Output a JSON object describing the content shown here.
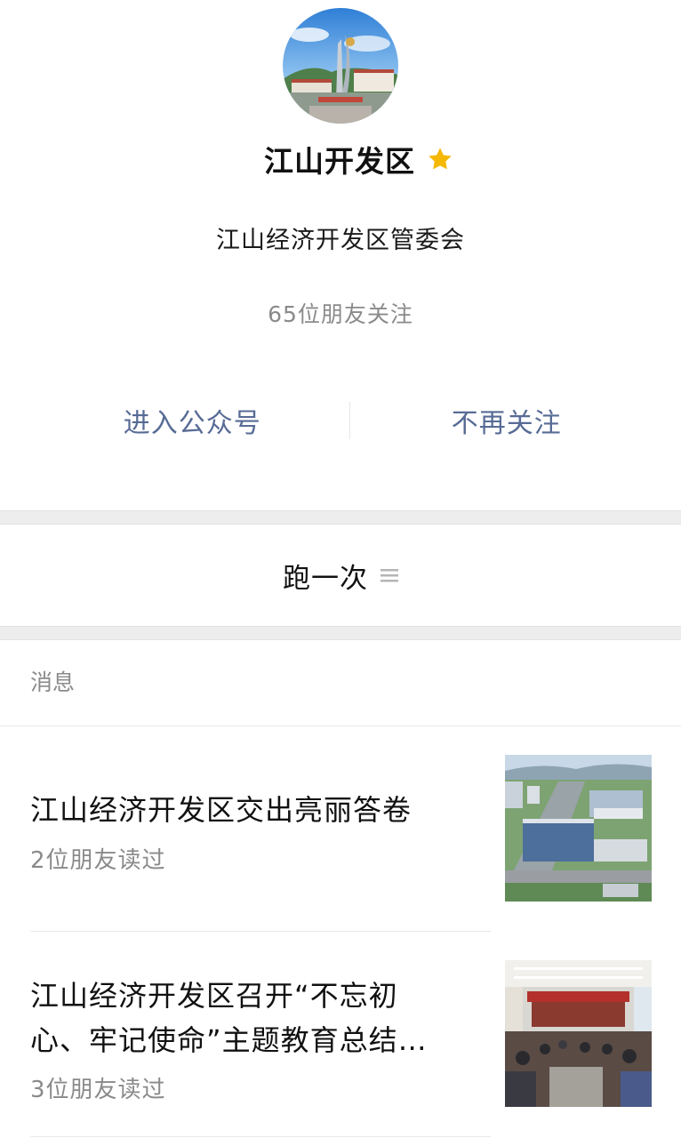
{
  "profile": {
    "name": "江山开发区",
    "organization": "江山经济开发区管委会",
    "followers_text": "65位朋友关注",
    "verified_icon": "star-icon",
    "accent_color": "#576b95",
    "star_color": "#f5b800"
  },
  "actions": {
    "enter": "进入公众号",
    "unfollow": "不再关注"
  },
  "menu": {
    "label": "跑一次",
    "icon": "menu-lines-icon"
  },
  "messages": {
    "section_title": "消息",
    "items": [
      {
        "title": "江山经济开发区交出亮丽答卷",
        "reads": "2位朋友读过",
        "thumb": "aerial-city-image"
      },
      {
        "title_line1": "江山经济开发区召开“不忘初",
        "title_line2": "心、牢记使命”主题教育总结…",
        "reads": "3位朋友读过",
        "thumb": "meeting-hall-image"
      }
    ]
  }
}
